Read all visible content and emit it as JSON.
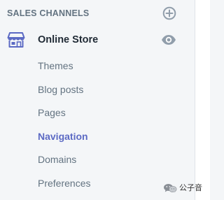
{
  "sidebar": {
    "section_title": "SALES CHANNELS",
    "channel": {
      "label": "Online Store",
      "icon": "store-icon"
    },
    "subitems": [
      {
        "label": "Themes",
        "active": false
      },
      {
        "label": "Blog posts",
        "active": false
      },
      {
        "label": "Pages",
        "active": false
      },
      {
        "label": "Navigation",
        "active": true
      },
      {
        "label": "Domains",
        "active": false
      },
      {
        "label": "Preferences",
        "active": false
      }
    ]
  },
  "watermark": {
    "text": "公子音"
  },
  "colors": {
    "background": "#f4f6f8",
    "section_title": "#637381",
    "icon_gray": "#919eab",
    "text_dark": "#212b36",
    "text_muted": "#637381",
    "active": "#5c6ac4",
    "store_icon": "#5c6ac4"
  }
}
